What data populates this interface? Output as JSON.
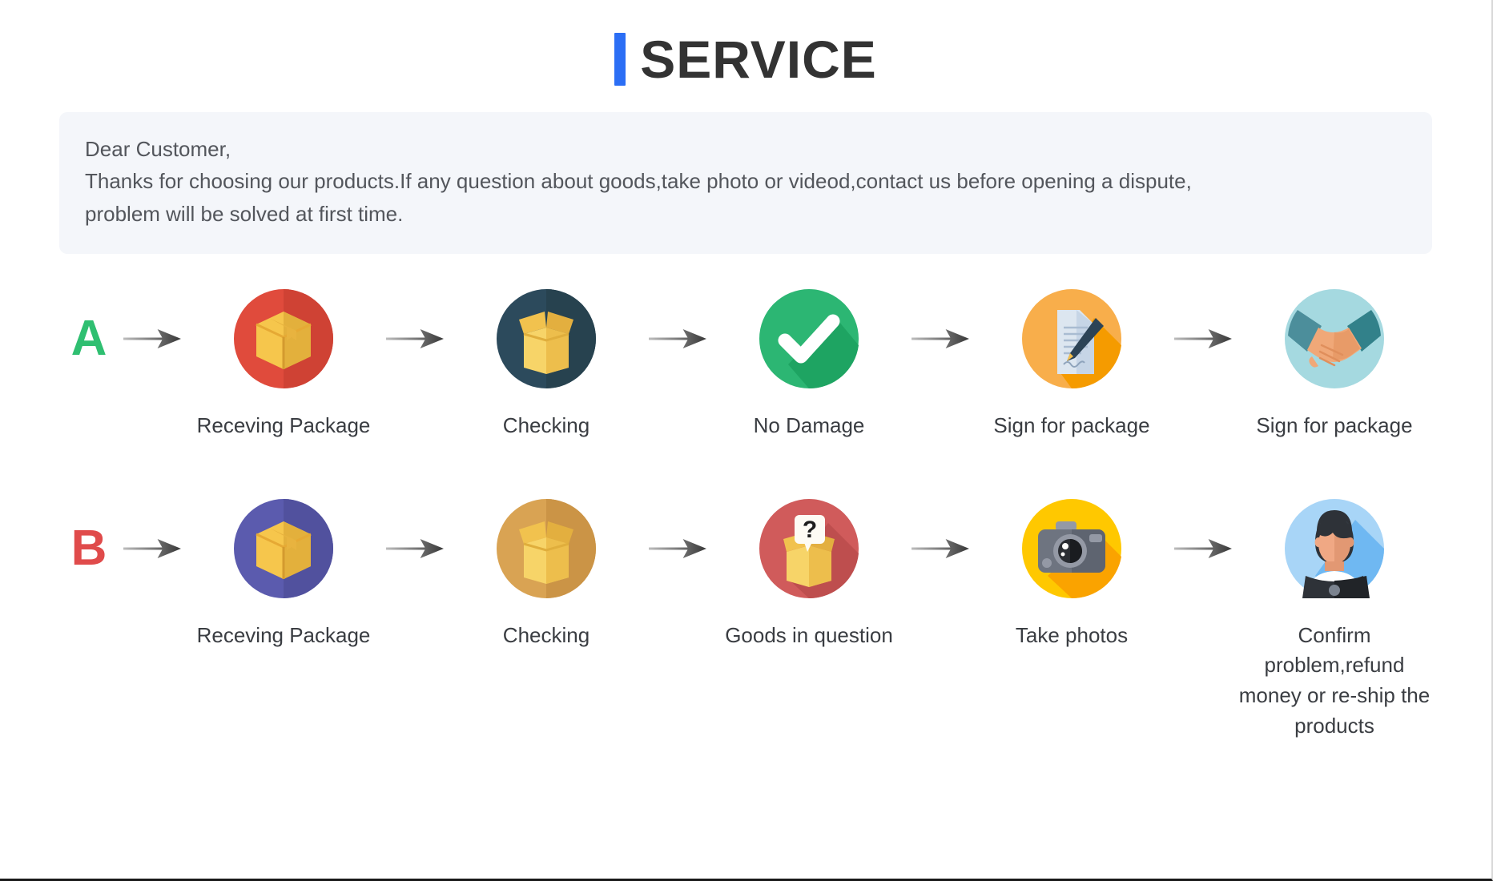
{
  "header": {
    "title": "SERVICE",
    "accent_color": "#2B6EF5",
    "title_color": "#333333"
  },
  "notice": {
    "line1": "Dear Customer,",
    "line2": "Thanks for choosing our products.If any question about goods,take photo or videod,contact us before opening a dispute,",
    "line3": "problem will be solved at first time.",
    "background": "#F4F6FA",
    "text_color": "#53565C"
  },
  "flows": [
    {
      "letter": "A",
      "letter_color": "#2FBF71",
      "steps": [
        {
          "icon": "package-box-icon",
          "label": "Receving Package",
          "circle_color": "#E04B3C"
        },
        {
          "icon": "open-box-icon",
          "label": "Checking",
          "circle_color": "#2C4A5C"
        },
        {
          "icon": "check-mark-icon",
          "label": "No Damage",
          "circle_color": "#2CB673"
        },
        {
          "icon": "document-sign-icon",
          "label": "Sign for package",
          "circle_color": "#F5A83D"
        },
        {
          "icon": "handshake-icon",
          "label": "Sign for package",
          "circle_color": "#A5D9E0"
        }
      ]
    },
    {
      "letter": "B",
      "letter_color": "#E04B4B",
      "steps": [
        {
          "icon": "package-box-icon",
          "label": "Receving Package",
          "circle_color": "#5B5BAE"
        },
        {
          "icon": "open-box-icon",
          "label": "Checking",
          "circle_color": "#D9A353"
        },
        {
          "icon": "question-box-icon",
          "label": "Goods in question",
          "circle_color": "#D05B5B"
        },
        {
          "icon": "camera-icon",
          "label": "Take photos",
          "circle_color": "#FFC800"
        },
        {
          "icon": "support-agent-icon",
          "label": "Confirm problem,refund money or re-ship the products",
          "circle_color": "#A8D5F7"
        }
      ]
    }
  ]
}
